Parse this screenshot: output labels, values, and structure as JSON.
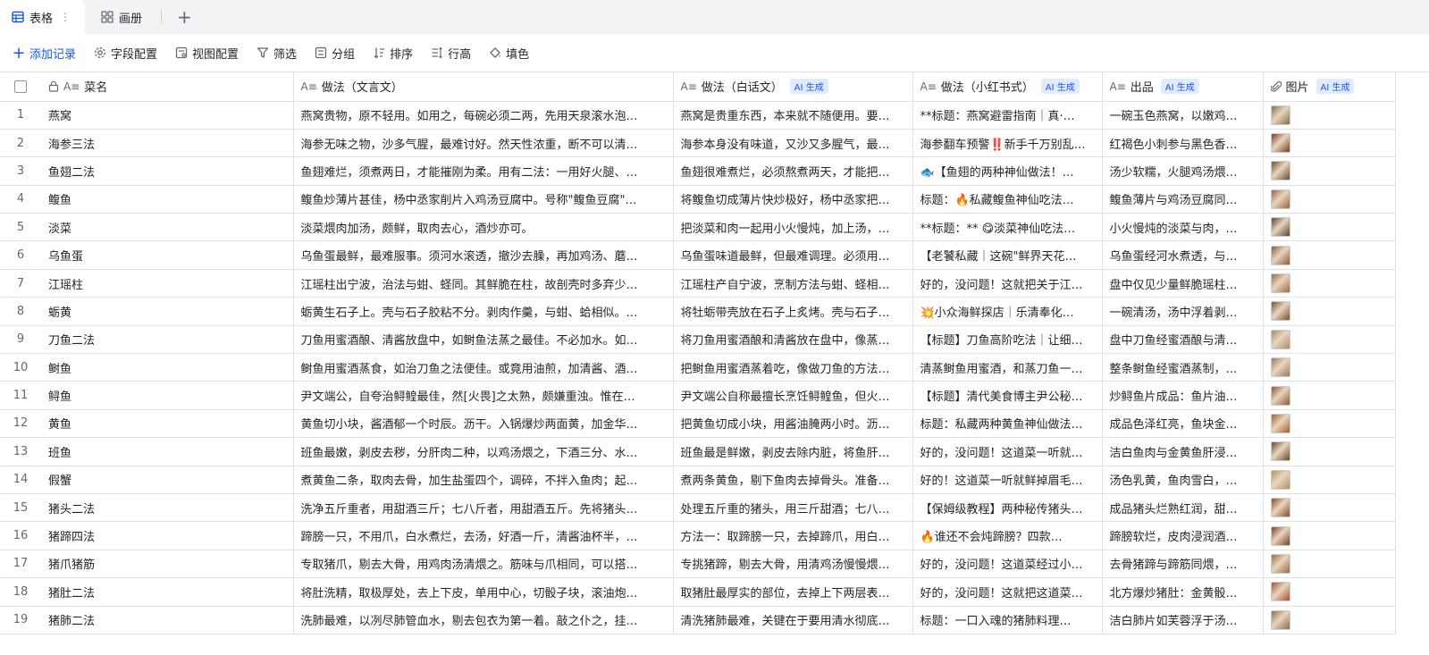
{
  "tabs": [
    {
      "label": "表格",
      "active": true
    },
    {
      "label": "画册",
      "active": false
    }
  ],
  "toolbar": {
    "add_record": "添加记录",
    "field_config": "字段配置",
    "view_config": "视图配置",
    "filter": "筛选",
    "group": "分组",
    "sort": "排序",
    "row_height": "行高",
    "fill": "填色"
  },
  "columns": {
    "name": "菜名",
    "classical": "做法（文言文）",
    "vernacular": "做法（白话文）",
    "xiaohongshu": "做法（小红书式）",
    "dish": "出品",
    "image": "图片",
    "ai_badge": "AI 生成"
  },
  "rows": [
    {
      "idx": "1",
      "name": "燕窝",
      "classical": "燕窝贵物，原不轻用。如用之，每碗必须二两，先用天泉滚水泡…",
      "vernacular": "燕窝是贵重东西，本来就不随便用。要…",
      "xhs": "**标题：燕窝避雷指南｜真‧…",
      "dish": "一碗玉色燕窝，以嫩鸡…",
      "thumb": "#8a6a4a"
    },
    {
      "idx": "2",
      "name": "海参三法",
      "classical": "海参无味之物，沙多气腥，最难讨好。然天性浓重，断不可以清…",
      "vernacular": "海参本身没有味道，又沙又多腥气，最…",
      "xhs": "海参翻车预警‼️新手千万别乱…",
      "dish": "红褐色小刺参与黑色香…",
      "thumb": "#7a3b22"
    },
    {
      "idx": "3",
      "name": "鱼翅二法",
      "classical": "鱼翅难烂，须煮两日，才能摧刚为柔。用有二法：一用好火腿、…",
      "vernacular": "鱼翅很难煮烂，必须熬煮两天，才能把…",
      "xhs": "🐟【鱼翅的两种神仙做法！…",
      "dish": "汤少软糯，火腿鸡汤煨…",
      "thumb": "#6b4a30"
    },
    {
      "idx": "4",
      "name": "鳆鱼",
      "classical": "鳆鱼炒薄片甚佳，杨中丞家削片入鸡汤豆腐中。号称\"鳆鱼豆腐\"…",
      "vernacular": "将鳆鱼切成薄片快炒极好，杨中丞家把…",
      "xhs": "标题：🔥私藏鳆鱼神仙吃法…",
      "dish": "鳆鱼薄片与鸡汤豆腐同…",
      "thumb": "#a0603a"
    },
    {
      "idx": "5",
      "name": "淡菜",
      "classical": "淡菜煨肉加汤，颇鲜，取肉去心，酒炒亦可。",
      "vernacular": "把淡菜和肉一起用小火慢炖，加上汤，…",
      "xhs": "**标题：** 😋淡菜神仙吃法…",
      "dish": "小火慢炖的淡菜与肉，…",
      "thumb": "#5a4030"
    },
    {
      "idx": "6",
      "name": "乌鱼蛋",
      "classical": "乌鱼蛋最鲜，最难服事。须河水滚透，撤沙去臊，再加鸡汤、蘑…",
      "vernacular": "乌鱼蛋味道最鲜，但最难调理。必须用…",
      "xhs": "【老饕私藏｜这碗\"鲜界天花…",
      "dish": "乌鱼蛋经河水煮透，与…",
      "thumb": "#8b5a35"
    },
    {
      "idx": "7",
      "name": "江瑶柱",
      "classical": "江瑶柱出宁波，治法与蚶、蛏同。其鲜脆在柱，故剖壳时多弃少…",
      "vernacular": "江瑶柱产自宁波，烹制方法与蚶、蛏相…",
      "xhs": "好的，没问题！这就把关于江…",
      "dish": "盘中仅见少量鲜脆瑶柱…",
      "thumb": "#9a6844"
    },
    {
      "idx": "8",
      "name": "蛎黄",
      "classical": "蛎黄生石子上。壳与石子胶粘不分。剥肉作羹，与蚶、蛤相似。…",
      "vernacular": "将牡蛎带壳放在石子上炙烤。壳与石子…",
      "xhs": "💥小众海鲜探店｜乐清奉化…",
      "dish": "一碗清汤，汤中浮着剥…",
      "thumb": "#7c4f2c"
    },
    {
      "idx": "9",
      "name": "刀鱼二法",
      "classical": "刀鱼用蜜酒酿、清酱放盘中，如鲥鱼法蒸之最佳。不必加水。如…",
      "vernacular": "将刀鱼用蜜酒酿和清酱放在盘中，像蒸…",
      "xhs": "【标题】刀鱼高阶吃法｜让细…",
      "dish": "盘中刀鱼经蜜酒酿与清…",
      "thumb": "#b08a6a"
    },
    {
      "idx": "10",
      "name": "鲥鱼",
      "classical": "鲥鱼用蜜酒蒸食，如治刀鱼之法便佳。或竟用油煎，加清酱、酒…",
      "vernacular": "把鲥鱼用蜜酒蒸着吃，像做刀鱼的方法…",
      "xhs": "清蒸鲥鱼用蜜酒，和蒸刀鱼一…",
      "dish": "整条鲥鱼经蜜酒蒸制，…",
      "thumb": "#a07858"
    },
    {
      "idx": "11",
      "name": "鲟鱼",
      "classical": "尹文端公，自夸治鲟鳇最佳，然[火畏]之太熟，颇嫌重浊。惟在…",
      "vernacular": "尹文端公自称最擅长烹饪鲟鳇鱼，但火…",
      "xhs": "【标题】清代美食博主尹公秘…",
      "dish": "炒鲟鱼片成品：鱼片油…",
      "thumb": "#8c5632"
    },
    {
      "idx": "12",
      "name": "黄鱼",
      "classical": "黄鱼切小块，酱酒郁一个时辰。沥干。入锅爆炒两面黄，加金华…",
      "vernacular": "把黄鱼切成小块，用酱油腌两小时。沥…",
      "xhs": "标题：私藏两种黄鱼神仙做法…",
      "dish": "成品色泽红亮，鱼块金…",
      "thumb": "#a65d2a"
    },
    {
      "idx": "13",
      "name": "班鱼",
      "classical": "班鱼最嫩，剥皮去秽，分肝肉二种，以鸡汤煨之，下酒三分、水…",
      "vernacular": "班鱼最是鲜嫩，剥皮去除内脏，将鱼肝…",
      "xhs": "好的，没问题！这道菜一听就…",
      "dish": "洁白鱼肉与金黄鱼肝浸…",
      "thumb": "#6e4428"
    },
    {
      "idx": "14",
      "name": "假蟹",
      "classical": "煮黄鱼二条，取肉去骨，加生盐蛋四个，调碎，不拌入鱼肉；起…",
      "vernacular": "煮两条黄鱼，剔下鱼肉去掉骨头。准备…",
      "xhs": "好的！这道菜一听就鲜掉眉毛…",
      "dish": "汤色乳黄，鱼肉雪白，…",
      "thumb": "#b7905e"
    },
    {
      "idx": "15",
      "name": "猪头二法",
      "classical": "洗净五斤重者，用甜酒三斤；七八斤者，用甜酒五斤。先将猪头…",
      "vernacular": "处理五斤重的猪头，用三斤甜酒；七八…",
      "xhs": "【保姆级教程】两种秘传猪头…",
      "dish": "成品猪头烂熟红润，甜…",
      "thumb": "#8a4a26"
    },
    {
      "idx": "16",
      "name": "猪蹄四法",
      "classical": "蹄膀一只，不用爪，白水煮烂，去汤，好酒一斤，清酱油杯半，…",
      "vernacular": "方法一：取蹄膀一只，去掉蹄爪，用白…",
      "xhs": "🔥谁还不会炖蹄膀？四款…",
      "dish": "蹄膀软烂，皮肉浸润酒…",
      "thumb": "#7d3f1e"
    },
    {
      "idx": "17",
      "name": "猪爪猪筋",
      "classical": "专取猪爪，剔去大骨，用鸡肉汤清煨之。筋味与爪相同，可以搭…",
      "vernacular": "专挑猪蹄，剔去大骨，用清鸡汤慢慢煨…",
      "xhs": "好的，没问题！这道菜经过小…",
      "dish": "去骨猪蹄与蹄筋同煨，…",
      "thumb": "#9b6a40"
    },
    {
      "idx": "18",
      "name": "猪肚二法",
      "classical": "将肚洗精，取极厚处，去上下皮，单用中心，切骰子块，滚油炮…",
      "vernacular": "取猪肚最厚实的部位，去掉上下两层表…",
      "xhs": "好的，没问题！这就把这道菜…",
      "dish": "北方爆炒猪肚：金黄骰…",
      "thumb": "#a0522d"
    },
    {
      "idx": "19",
      "name": "猪肺二法",
      "classical": "洗肺最难，以冽尽肺管血水，剔去包衣为第一着。敲之仆之，挂…",
      "vernacular": "清洗猪肺最难，关键在于要用清水彻底…",
      "xhs": "标题：一口入魂的猪肺料理…",
      "dish": "洁白肺片如芙蓉浮于汤…",
      "thumb": "#8e6a4c"
    }
  ]
}
